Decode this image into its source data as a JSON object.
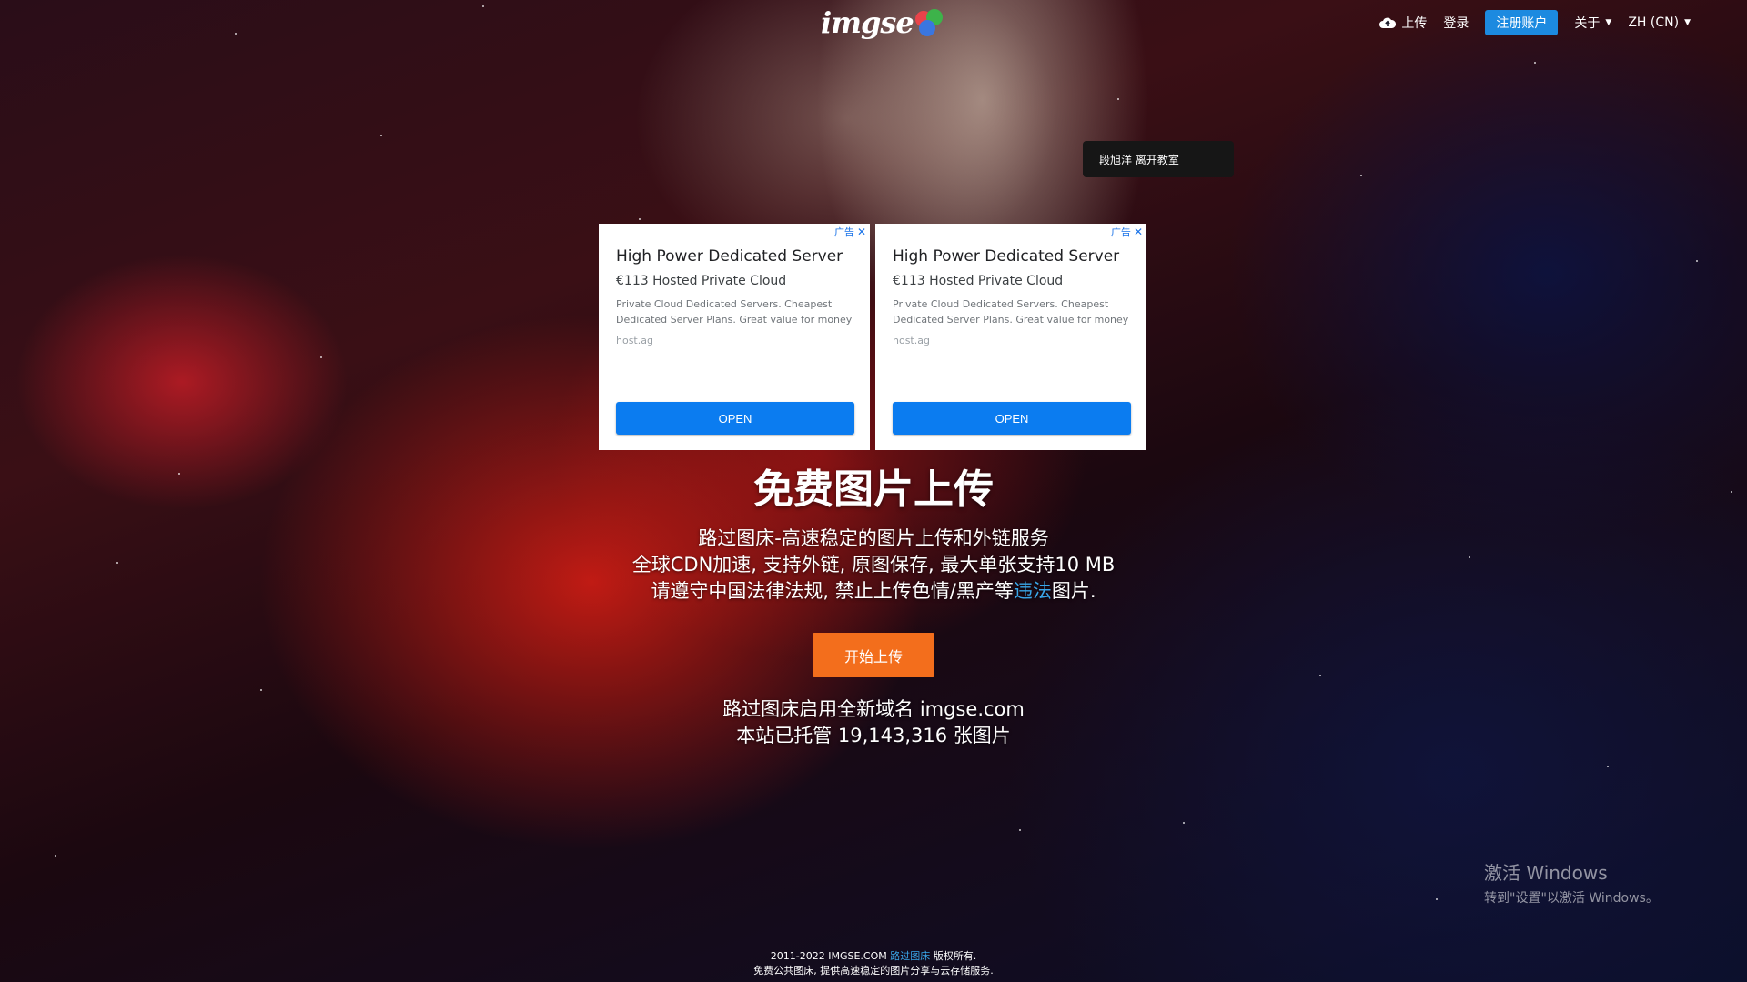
{
  "header": {
    "logo_text": "imgse",
    "nav": {
      "upload_label": "上传",
      "login_label": "登录",
      "register_label": "注册账户",
      "about_label": "关于",
      "language_label": "ZH (CN)"
    }
  },
  "popup": {
    "text": "段旭洋 离开教室"
  },
  "ads": [
    {
      "badge": "广告",
      "title": "High Power Dedicated Server",
      "subtitle": "€113 Hosted Private Cloud",
      "description": "Private Cloud Dedicated Servers. Cheapest Dedicated Server Plans. Great value for money",
      "domain": "host.ag",
      "button": "OPEN"
    },
    {
      "badge": "广告",
      "title": "High Power Dedicated Server",
      "subtitle": "€113 Hosted Private Cloud",
      "description": "Private Cloud Dedicated Servers. Cheapest Dedicated Server Plans. Great value for money",
      "domain": "host.ag",
      "button": "OPEN"
    }
  ],
  "hero": {
    "title": "免费图片上传",
    "line1": "路过图床-高速稳定的图片上传和外链服务",
    "line2": "全球CDN加速, 支持外链, 原图保存, 最大单张支持10 MB",
    "line3_prefix": "请遵守中国法律法规, 禁止上传色情/黑产等",
    "line3_link": "违法",
    "line3_suffix": "图片.",
    "start_button": "开始上传",
    "stats_line1": "路过图床启用全新域名 imgse.com",
    "stats_line2": "本站已托管 19,143,316 张图片"
  },
  "watermark": {
    "line1": "激活 Windows",
    "line2": "转到\"设置\"以激活 Windows。"
  },
  "footer": {
    "line1_prefix": "2011-2022 IMGSE.COM",
    "line1_link": "路过图床",
    "line1_suffix": "版权所有.",
    "line2": "免费公共图床, 提供高速稳定的图片分享与云存储服务."
  },
  "colors": {
    "accent_blue": "#1c8ae0",
    "start_orange": "#f36e1c",
    "ad_button_blue": "#0b7cf0",
    "link_blue": "#3aa6e8"
  }
}
